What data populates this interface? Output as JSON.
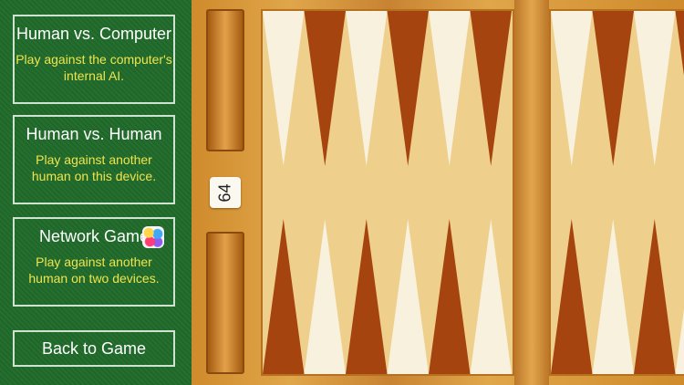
{
  "menu": {
    "cards": [
      {
        "title": "Human vs. Computer",
        "desc": "Play against the computer's internal AI."
      },
      {
        "title": "Human vs. Human",
        "desc": "Play against another human on this device."
      },
      {
        "title": "Network Game",
        "desc": "Play against another human on two devices."
      }
    ],
    "back_label": "Back to Game"
  },
  "board": {
    "doubling_cube": "64"
  },
  "colors": {
    "menu_bg": "#1f6a2a",
    "menu_desc": "#f0e44d",
    "point_dark": "#a5440e",
    "point_light": "#f7f1de"
  }
}
